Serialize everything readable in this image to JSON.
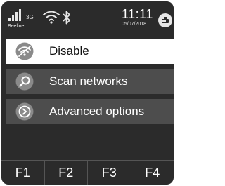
{
  "status_bar": {
    "network_type": "3G",
    "carrier": "Beeline",
    "time": "11:11",
    "date": "05/07/2018",
    "icons": [
      "signal-icon",
      "wifi-icon",
      "bluetooth-icon",
      "battery-icon"
    ]
  },
  "menu": {
    "items": [
      {
        "label": "Disable",
        "icon": "wifi-off-icon",
        "selected": true
      },
      {
        "label": "Scan networks",
        "icon": "search-icon",
        "selected": false
      },
      {
        "label": "Advanced options",
        "icon": "arrow-right-icon",
        "selected": false
      }
    ]
  },
  "function_keys": [
    "F1",
    "F2",
    "F3",
    "F4"
  ],
  "colors": {
    "background": "#2b2b2b",
    "menu_item": "#4d4d4d",
    "selected_item": "#ffffff",
    "text": "#ffffff",
    "icon_gray": "#8a8a8a"
  }
}
